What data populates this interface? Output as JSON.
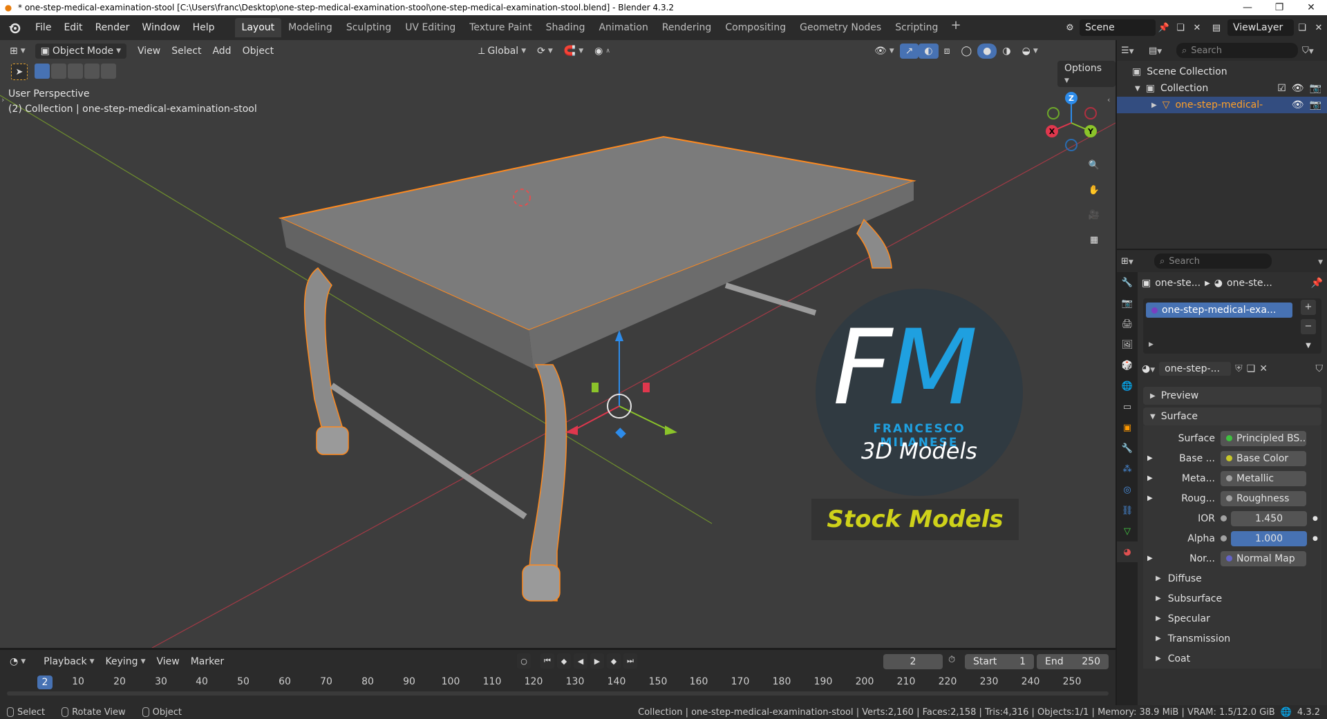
{
  "window": {
    "title": "* one-step-medical-examination-stool [C:\\Users\\franc\\Desktop\\one-step-medical-examination-stool\\one-step-medical-examination-stool.blend] - Blender 4.3.2",
    "minimize": "—",
    "maximize": "❐",
    "close": "✕"
  },
  "menu": {
    "items": [
      "File",
      "Edit",
      "Render",
      "Window",
      "Help"
    ]
  },
  "workspaces": {
    "tabs": [
      "Layout",
      "Modeling",
      "Sculpting",
      "UV Editing",
      "Texture Paint",
      "Shading",
      "Animation",
      "Rendering",
      "Compositing",
      "Geometry Nodes",
      "Scripting"
    ],
    "active": "Layout",
    "add": "+"
  },
  "scene": {
    "name": "Scene",
    "view_layer": "ViewLayer"
  },
  "viewport": {
    "mode": "Object Mode",
    "menus": [
      "View",
      "Select",
      "Add",
      "Object"
    ],
    "transform_orientation": "Global",
    "options": "Options",
    "perspective": "User Perspective",
    "collection_info": "(2) Collection | one-step-medical-examination-stool",
    "gizmo_axes": {
      "x": "X",
      "y": "Y",
      "z": "Z"
    }
  },
  "watermark": {
    "letters_f": "F",
    "letters_m": "M",
    "author": "FRANCESCO MILANESE",
    "subtitle": "3D Models",
    "banner": "Stock Models"
  },
  "timeline": {
    "menus": [
      "Playback",
      "Keying",
      "View",
      "Marker"
    ],
    "current_frame": "2",
    "start_label": "Start",
    "start": "1",
    "end_label": "End",
    "end": "250",
    "ticks": [
      "10",
      "20",
      "30",
      "40",
      "50",
      "60",
      "70",
      "80",
      "90",
      "100",
      "110",
      "120",
      "130",
      "140",
      "150",
      "160",
      "170",
      "180",
      "190",
      "200",
      "210",
      "220",
      "230",
      "240",
      "250"
    ],
    "playhead": "2"
  },
  "statusbar": {
    "select": "Select",
    "rotate": "Rotate View",
    "object": "Object",
    "stats": "Collection | one-step-medical-examination-stool | Verts:2,160 | Faces:2,158 | Tris:4,316 | Objects:1/1 | Memory: 38.9 MiB | VRAM: 1.5/12.0 GiB",
    "version": "4.3.2"
  },
  "outliner": {
    "search_placeholder": "Search",
    "scene_collection": "Scene Collection",
    "collection": "Collection",
    "object": "one-step-medical-"
  },
  "properties": {
    "search_placeholder": "Search",
    "breadcrumb_object": "one-ste...",
    "breadcrumb_material": "one-ste...",
    "material_slot": "one-step-medical-exa...",
    "material_name": "one-step-...",
    "panels": {
      "preview": "Preview",
      "surface": "Surface"
    },
    "rows": [
      {
        "label": "Surface",
        "value": "Principled BS...",
        "dot": "#3fbf3f"
      },
      {
        "label": "Base ...",
        "value": "Base Color",
        "dot": "#c7c729"
      },
      {
        "label": "Meta...",
        "value": "Metallic",
        "dot": "#a1a1a1"
      },
      {
        "label": "Roug...",
        "value": "Roughness",
        "dot": "#a1a1a1"
      },
      {
        "label": "IOR",
        "value": "1.450",
        "dot": "#a1a1a1"
      },
      {
        "label": "Alpha",
        "value": "1.000",
        "dot": "#a1a1a1"
      },
      {
        "label": "Nor...",
        "value": "Normal Map",
        "dot": "#6363c7"
      }
    ],
    "subpanels": [
      "Diffuse",
      "Subsurface",
      "Specular",
      "Transmission",
      "Coat"
    ]
  },
  "colors": {
    "accent_blue": "#4772b3",
    "selection_orange": "#ffa028",
    "axis_x": "#e0374d",
    "axis_y": "#8bc42a",
    "axis_z": "#2d8ceb",
    "watermark_blue": "#1fa0e0",
    "watermark_yellow": "#cfd21a"
  }
}
